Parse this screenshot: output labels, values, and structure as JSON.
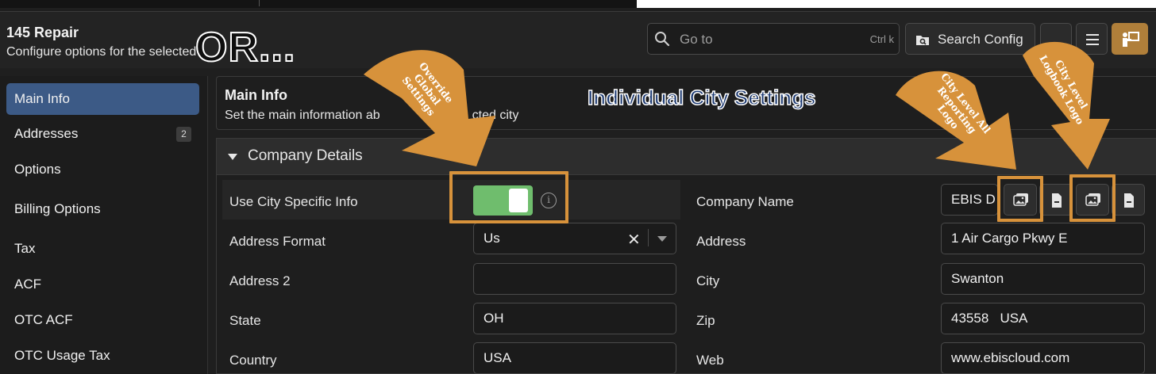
{
  "header": {
    "title": "145 Repair",
    "subtitle": "Configure options for the selected",
    "goto_placeholder": "Go to",
    "goto_shortcut": "Ctrl k",
    "search_config_label": "Search Config"
  },
  "sidebar": {
    "items": [
      {
        "label": "Main Info",
        "active": true
      },
      {
        "label": "Addresses",
        "badge": "2"
      },
      {
        "label": "Options"
      },
      {
        "label": "Billing Options"
      },
      {
        "label": "Tax"
      },
      {
        "label": "ACF"
      },
      {
        "label": "OTC ACF"
      },
      {
        "label": "OTC Usage Tax"
      }
    ]
  },
  "main": {
    "title": "Main Info",
    "subtitle": "Set the main information ab",
    "subtitle_tail": "cted city"
  },
  "company_details": {
    "section_title": "Company Details",
    "use_city_specific_label": "Use City Specific Info",
    "use_city_specific_value": true,
    "address_format_label": "Address Format",
    "address_format_value": "Us",
    "address2_label": "Address 2",
    "address2_value": "",
    "state_label": "State",
    "state_value": "OH",
    "country_label": "Country",
    "country_value": "USA",
    "company_name_label": "Company Name",
    "company_name_value": "EBIS D",
    "address_label": "Address",
    "address_value": "1 Air Cargo Pkwy E",
    "city_label": "City",
    "city_value": "Swanton",
    "zip_label": "Zip",
    "zip_value": "43558   USA",
    "web_label": "Web",
    "web_value": "www.ebiscloud.com"
  },
  "annotations": {
    "or_text": "OR...",
    "individual_city": "Individual City Settings",
    "override_global": [
      "Override",
      "Global",
      "Settings"
    ],
    "city_reporting_logo": [
      "City Level All",
      "Reporting",
      "Logo"
    ],
    "city_logbook_logo": [
      "City Level",
      "Logbook Logo"
    ],
    "accent_color": "#d7923b"
  },
  "colors": {
    "toggle_on": "#6fbd6d",
    "nav_active": "#3c5a86",
    "user_button": "#b07f3a"
  }
}
